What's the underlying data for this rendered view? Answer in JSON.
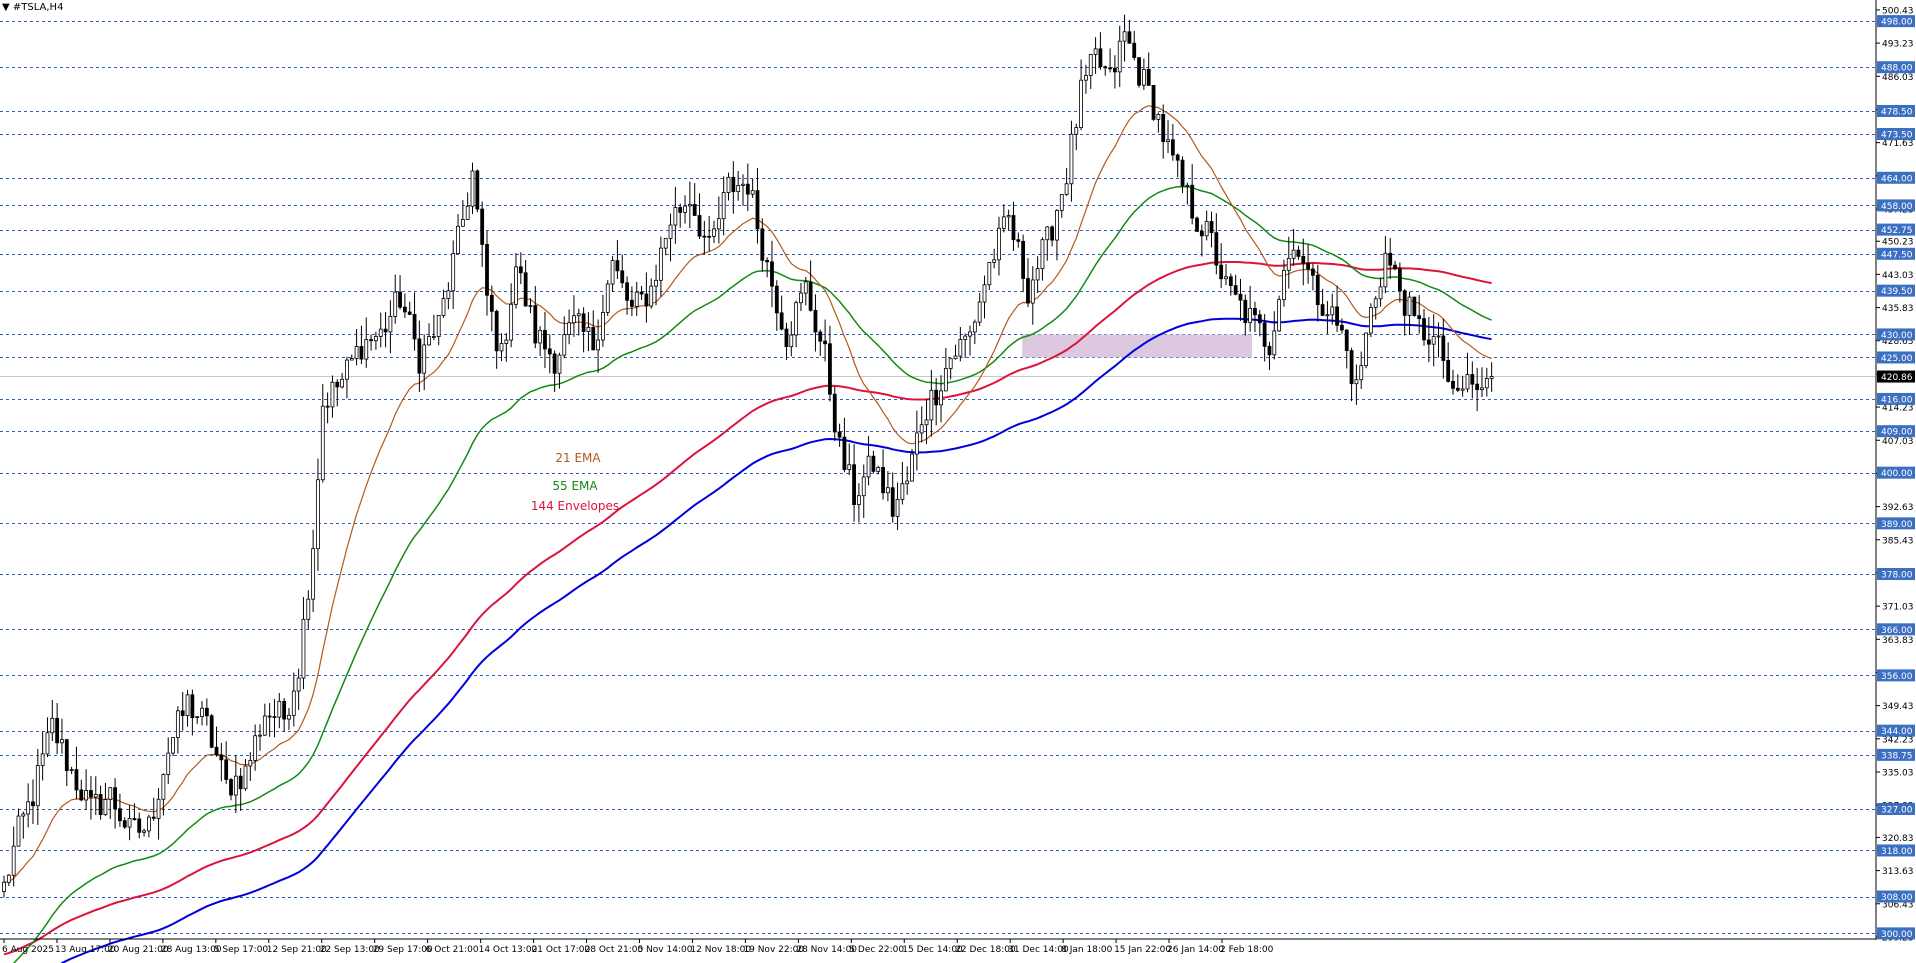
{
  "window_title": "#TSLA,H4",
  "title_arrow": "▼",
  "current_price": "420.86",
  "indicator_labels": [
    {
      "text": "21 EMA",
      "color": "#b5581e"
    },
    {
      "text": "55 EMA",
      "color": "#138a13"
    },
    {
      "text": "144 Envelopes",
      "color": "#dc143c"
    }
  ],
  "colors": {
    "ema21": "#b5581e",
    "ema55": "#138a13",
    "env_upper": "#dc143c",
    "env_lower": "#0000dd",
    "level_line": "#2d5fb3",
    "level_tag_bg": "#3b6fc1",
    "zone_fill": "#d8c2dc",
    "candle": "#000000",
    "background": "#ffffff"
  },
  "chart_data": {
    "type": "candlestick",
    "symbol": "#TSLA",
    "timeframe": "H4",
    "ylim": [
      299.0,
      501.5
    ],
    "y_ticks": [
      "500.43",
      "493.23",
      "486.03",
      "478.83",
      "471.63",
      "464.43",
      "457.23",
      "450.23",
      "443.03",
      "435.83",
      "428.63",
      "421.43",
      "414.23",
      "407.03",
      "399.83",
      "392.63",
      "385.43",
      "378.23",
      "371.03",
      "363.83",
      "356.63",
      "349.43",
      "342.23",
      "335.03",
      "327.83",
      "320.83",
      "313.63",
      "306.43",
      "299.23"
    ],
    "x_ticks": [
      "6 Aug 2025",
      "13 Aug 17:00",
      "20 Aug 21:00",
      "28 Aug 13:00",
      "5 Sep 17:00",
      "12 Sep 21:00",
      "22 Sep 13:00",
      "29 Sep 17:00",
      "6 Oct 21:00",
      "14 Oct 13:00",
      "21 Oct 17:00",
      "28 Oct 21:00",
      "5 Nov 14:00",
      "12 Nov 18:00",
      "19 Nov 22:00",
      "28 Nov 14:00",
      "5 Dec 22:00",
      "15 Dec 14:00",
      "22 Dec 18:00",
      "31 Dec 14:00",
      "8 Jan 18:00",
      "15 Jan 22:00",
      "26 Jan 14:00",
      "2 Feb 18:00"
    ],
    "horizontal_levels": [
      "498.00",
      "488.00",
      "478.50",
      "473.50",
      "464.00",
      "458.00",
      "452.75",
      "447.50",
      "439.50",
      "430.00",
      "425.00",
      "416.00",
      "409.00",
      "400.00",
      "389.00",
      "378.00",
      "366.00",
      "356.00",
      "344.00",
      "338.75",
      "327.00",
      "318.00",
      "308.00",
      "300.00"
    ],
    "zone": {
      "from": "425.00",
      "to": "430.00",
      "start": "31 Dec 14:00",
      "end": "2 Feb 18:00"
    },
    "price_anchors": [
      {
        "t": 0,
        "p": 310
      },
      {
        "t": 3,
        "p": 322
      },
      {
        "t": 6,
        "p": 330
      },
      {
        "t": 10,
        "p": 345
      },
      {
        "t": 14,
        "p": 335
      },
      {
        "t": 18,
        "p": 327
      },
      {
        "t": 22,
        "p": 330
      },
      {
        "t": 26,
        "p": 322
      },
      {
        "t": 30,
        "p": 323
      },
      {
        "t": 34,
        "p": 340
      },
      {
        "t": 38,
        "p": 350
      },
      {
        "t": 42,
        "p": 345
      },
      {
        "t": 46,
        "p": 332
      },
      {
        "t": 50,
        "p": 335
      },
      {
        "t": 54,
        "p": 348
      },
      {
        "t": 58,
        "p": 347
      },
      {
        "t": 61,
        "p": 358
      },
      {
        "t": 64,
        "p": 385
      },
      {
        "t": 66,
        "p": 415
      },
      {
        "t": 70,
        "p": 420
      },
      {
        "t": 74,
        "p": 428
      },
      {
        "t": 78,
        "p": 430
      },
      {
        "t": 82,
        "p": 438
      },
      {
        "t": 86,
        "p": 425
      },
      {
        "t": 90,
        "p": 432
      },
      {
        "t": 94,
        "p": 450
      },
      {
        "t": 97,
        "p": 465
      },
      {
        "t": 100,
        "p": 438
      },
      {
        "t": 103,
        "p": 425
      },
      {
        "t": 106,
        "p": 445
      },
      {
        "t": 110,
        "p": 430
      },
      {
        "t": 114,
        "p": 425
      },
      {
        "t": 118,
        "p": 432
      },
      {
        "t": 122,
        "p": 428
      },
      {
        "t": 126,
        "p": 445
      },
      {
        "t": 130,
        "p": 435
      },
      {
        "t": 134,
        "p": 440
      },
      {
        "t": 138,
        "p": 455
      },
      {
        "t": 142,
        "p": 460
      },
      {
        "t": 146,
        "p": 448
      },
      {
        "t": 150,
        "p": 462
      },
      {
        "t": 154,
        "p": 463
      },
      {
        "t": 158,
        "p": 445
      },
      {
        "t": 162,
        "p": 430
      },
      {
        "t": 166,
        "p": 440
      },
      {
        "t": 170,
        "p": 425
      },
      {
        "t": 173,
        "p": 405
      },
      {
        "t": 176,
        "p": 395
      },
      {
        "t": 180,
        "p": 402
      },
      {
        "t": 184,
        "p": 392
      },
      {
        "t": 187,
        "p": 398
      },
      {
        "t": 190,
        "p": 412
      },
      {
        "t": 193,
        "p": 418
      },
      {
        "t": 196,
        "p": 425
      },
      {
        "t": 200,
        "p": 430
      },
      {
        "t": 204,
        "p": 445
      },
      {
        "t": 208,
        "p": 455
      },
      {
        "t": 212,
        "p": 440
      },
      {
        "t": 216,
        "p": 450
      },
      {
        "t": 220,
        "p": 465
      },
      {
        "t": 223,
        "p": 482
      },
      {
        "t": 226,
        "p": 490
      },
      {
        "t": 229,
        "p": 485
      },
      {
        "t": 232,
        "p": 495
      },
      {
        "t": 235,
        "p": 487
      },
      {
        "t": 238,
        "p": 480
      },
      {
        "t": 241,
        "p": 470
      },
      {
        "t": 244,
        "p": 462
      },
      {
        "t": 247,
        "p": 455
      },
      {
        "t": 250,
        "p": 450
      },
      {
        "t": 253,
        "p": 440
      },
      {
        "t": 256,
        "p": 436
      },
      {
        "t": 259,
        "p": 432
      },
      {
        "t": 262,
        "p": 428
      },
      {
        "t": 265,
        "p": 445
      },
      {
        "t": 268,
        "p": 450
      },
      {
        "t": 271,
        "p": 440
      },
      {
        "t": 274,
        "p": 436
      },
      {
        "t": 277,
        "p": 430
      },
      {
        "t": 280,
        "p": 418
      },
      {
        "t": 283,
        "p": 435
      },
      {
        "t": 286,
        "p": 447
      },
      {
        "t": 289,
        "p": 440
      },
      {
        "t": 292,
        "p": 432
      },
      {
        "t": 295,
        "p": 430
      },
      {
        "t": 298,
        "p": 425
      },
      {
        "t": 300,
        "p": 415
      },
      {
        "t": 303,
        "p": 420
      },
      {
        "t": 306,
        "p": 417
      },
      {
        "t": 308,
        "p": 420.86
      }
    ],
    "series": [
      {
        "name": "21 EMA",
        "period": 21,
        "color": "#b5581e"
      },
      {
        "name": "55 EMA",
        "period": 55,
        "color": "#138a13"
      },
      {
        "name": "144 Envelopes",
        "period": 144,
        "color": "#dc143c",
        "color2": "#0000dd",
        "deviation_pct": 1.4
      }
    ],
    "grid": false
  }
}
